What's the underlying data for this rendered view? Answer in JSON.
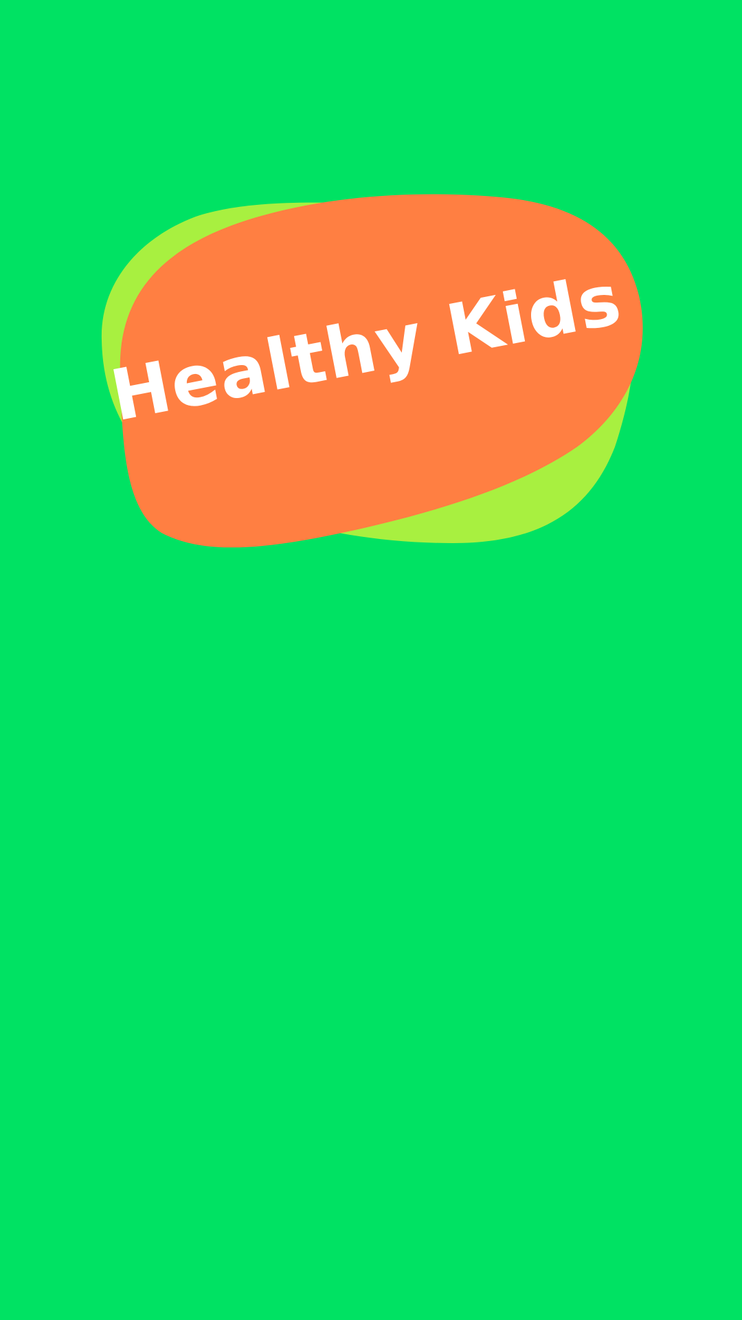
{
  "screen": {
    "name": "splash-screen",
    "background_color": "#00E263"
  },
  "logo": {
    "text": "Healthy Kids",
    "text_color": "#FFFFFF",
    "blob_front_color": "#FF7F42",
    "blob_back_color": "#A8F040"
  }
}
